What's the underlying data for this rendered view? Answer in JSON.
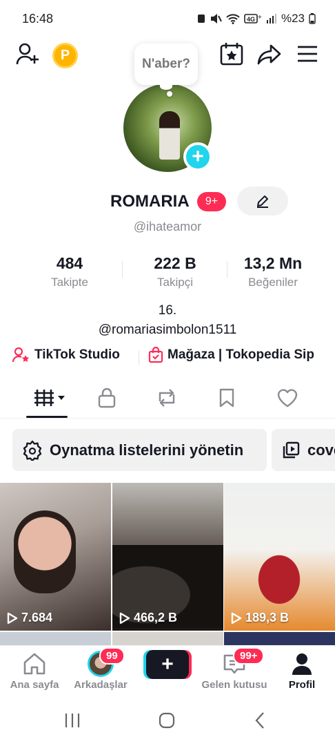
{
  "status_bar": {
    "time": "16:48",
    "battery": "%23"
  },
  "top_bar": {
    "coin_label": "P"
  },
  "profile": {
    "bubble_text": "N'aber?",
    "username": "ROMARIA",
    "badge": "9+",
    "handle": "@ihateamor",
    "bio_line1": "16.",
    "bio_line2": "@romariasimbolon1511"
  },
  "stats": [
    {
      "value": "484",
      "label": "Takipte"
    },
    {
      "value": "222 B",
      "label": "Takipçi"
    },
    {
      "value": "13,2 Mn",
      "label": "Beğeniler"
    }
  ],
  "links": {
    "studio": "TikTok Studio",
    "shop": "Mağaza | Tokopedia Sip"
  },
  "chips": {
    "playlists": "Oynatma listelerini yönetin",
    "cover": "cove"
  },
  "videos": [
    {
      "views": "7.684"
    },
    {
      "views": "466,2 B"
    },
    {
      "views": "189,3 B"
    }
  ],
  "bottom_nav": {
    "home": "Ana sayfa",
    "friends": "Arkadaşlar",
    "friends_badge": "99",
    "inbox": "Gelen kutusu",
    "inbox_badge": "99+",
    "profile": "Profil"
  },
  "colors": {
    "accent_red": "#fe2c55",
    "accent_cyan": "#20d5ec",
    "coin": "#ffb400"
  }
}
